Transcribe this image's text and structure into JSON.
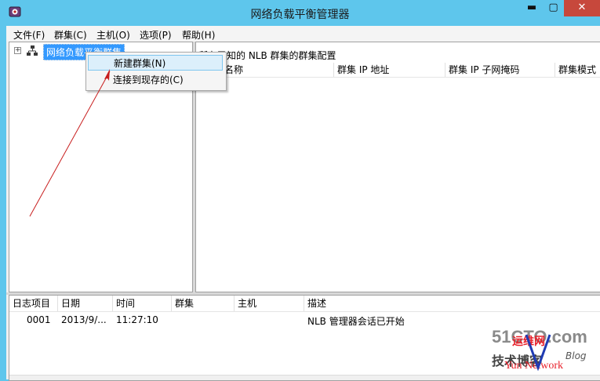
{
  "window": {
    "title": "网络负载平衡管理器",
    "minimize": "▬",
    "maximize": "▢",
    "close": "✕"
  },
  "menu": [
    "文件(F)",
    "群集(C)",
    "主机(O)",
    "选项(P)",
    "帮助(H)"
  ],
  "tree": {
    "expander": "+",
    "root_label": "网络负载平衡群集"
  },
  "context_menu": {
    "items": [
      "新建群集(N)",
      "连接到现存的(C)"
    ]
  },
  "right_pane": {
    "header": "所有已知的 NLB 群集的群集配置",
    "columns": [
      "名称",
      "群集 IP 地址",
      "群集 IP 子网掩码",
      "群集模式"
    ]
  },
  "log": {
    "columns": [
      "日志项目",
      "日期",
      "时间",
      "群集",
      "主机",
      "描述"
    ],
    "rows": [
      {
        "id": "0001",
        "date": "2013/9/...",
        "time": "11:27:10",
        "cluster": "",
        "host": "",
        "desc": "NLB 管理器会话已开始"
      }
    ]
  },
  "watermark": {
    "line1": "51CTO.com",
    "line2": "技术博客",
    "line3": "运维网",
    "line4": "Blog",
    "line5": "Yun Network"
  },
  "colors": {
    "titlebar": "#5ec6ec",
    "selection": "#3399ff",
    "close": "#c7483c",
    "annotation": "#c81e1e"
  }
}
